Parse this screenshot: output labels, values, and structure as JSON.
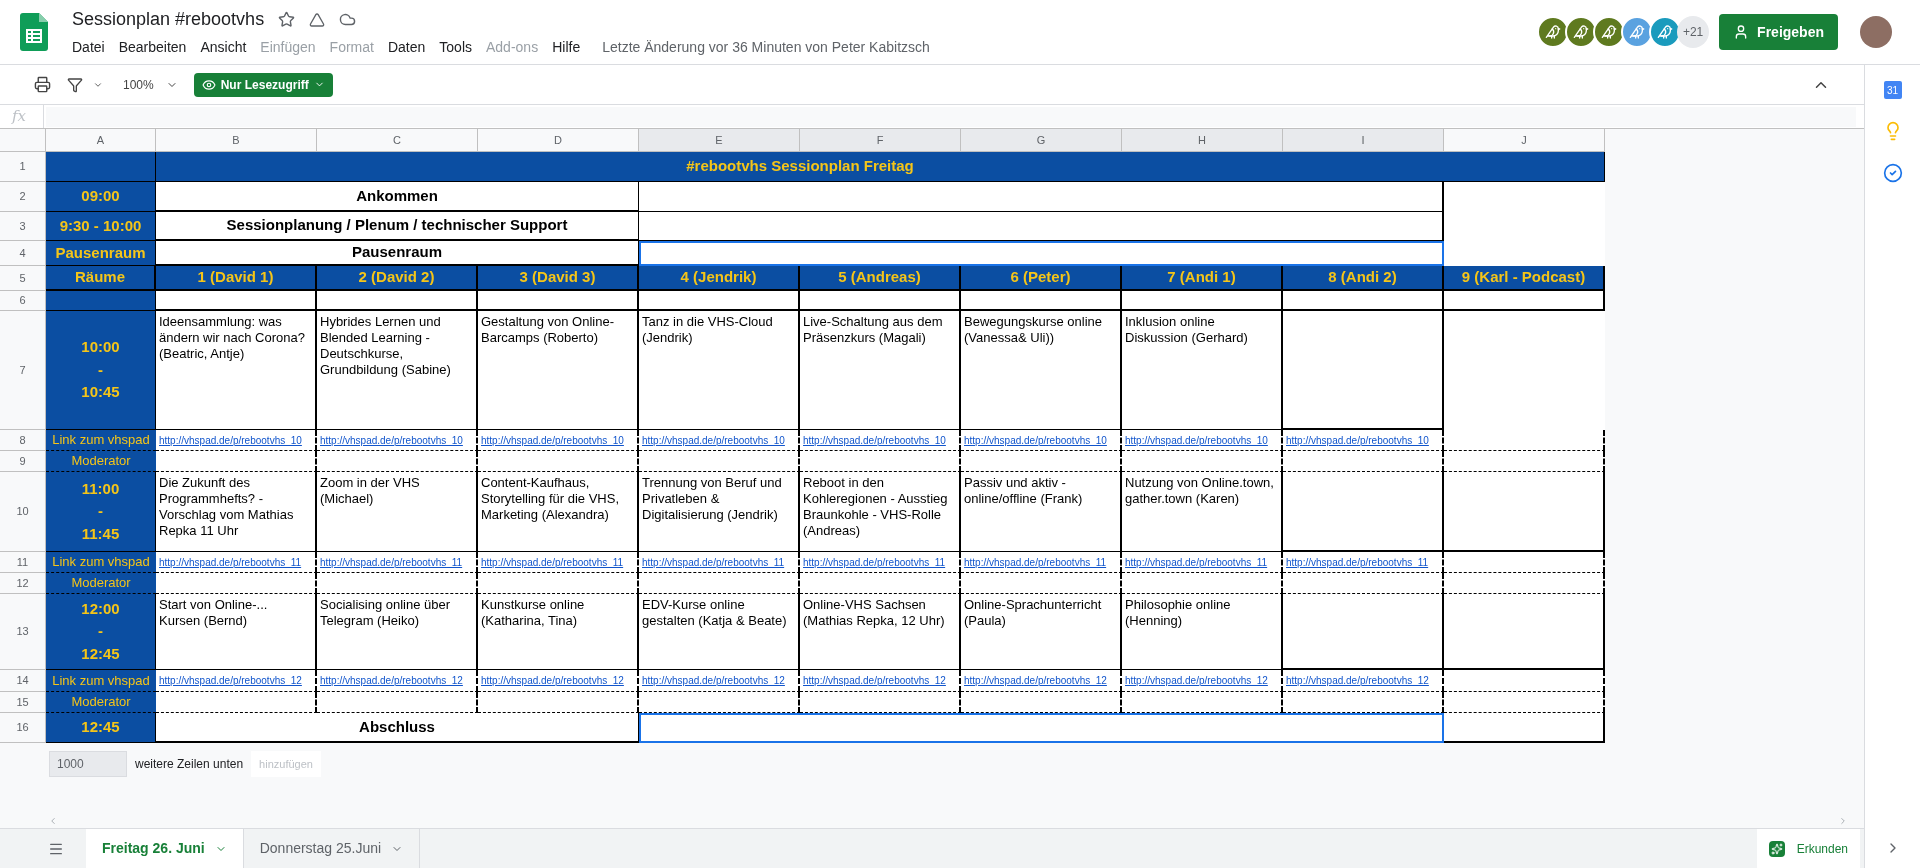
{
  "document": {
    "title": "Sessionplan #rebootvhs",
    "last_edit": "Letzte Änderung vor 36 Minuten von Peter Kabitzsch"
  },
  "menu": [
    {
      "label": "Datei",
      "disabled": false
    },
    {
      "label": "Bearbeiten",
      "disabled": false
    },
    {
      "label": "Ansicht",
      "disabled": false
    },
    {
      "label": "Einfügen",
      "disabled": true
    },
    {
      "label": "Format",
      "disabled": true
    },
    {
      "label": "Daten",
      "disabled": false
    },
    {
      "label": "Tools",
      "disabled": false
    },
    {
      "label": "Add-ons",
      "disabled": true
    },
    {
      "label": "Hilfe",
      "disabled": false
    }
  ],
  "collaborators": {
    "avatars": [
      {
        "color": "#5f7a1f"
      },
      {
        "color": "#5f7a1f"
      },
      {
        "color": "#5f7a1f"
      },
      {
        "color": "#5aa2e0"
      },
      {
        "color": "#1a9bbd"
      }
    ],
    "more": "+21"
  },
  "share_button": "Freigeben",
  "toolbar": {
    "zoom": "100%",
    "mode": "Nur Lesezugriff"
  },
  "formula_bar": {
    "label": "fx"
  },
  "side_panel": {
    "calendar": "31"
  },
  "columns": [
    {
      "label": "A",
      "selected": false
    },
    {
      "label": "B",
      "selected": false
    },
    {
      "label": "C",
      "selected": false
    },
    {
      "label": "D",
      "selected": false
    },
    {
      "label": "E",
      "selected": true
    },
    {
      "label": "F",
      "selected": true
    },
    {
      "label": "G",
      "selected": true
    },
    {
      "label": "H",
      "selected": true
    },
    {
      "label": "I",
      "selected": true
    },
    {
      "label": "J",
      "selected": false
    }
  ],
  "rows": [
    {
      "number": "1",
      "cells": [
        {
          "kind": "blue"
        },
        {
          "kind": "title",
          "text": "#rebootvhs Sessionplan Freitag"
        },
        {
          "kind": "blue"
        }
      ]
    },
    {
      "number": "2",
      "cells": [
        {
          "kind": "time",
          "lines": [
            "09:00"
          ]
        },
        {
          "kind": "heading",
          "text": "Ankommen"
        },
        {
          "kind": "wide"
        },
        {
          "kind": "none"
        }
      ]
    },
    {
      "number": "3",
      "cells": [
        {
          "kind": "time",
          "lines": [
            "9:30 - 10:00"
          ]
        },
        {
          "kind": "heading",
          "text": "Sessionplanung / Plenum / technischer Support"
        },
        {
          "kind": "wide"
        },
        {
          "kind": "none"
        }
      ]
    },
    {
      "number": "4",
      "cells": [
        {
          "kind": "time",
          "lines": [
            "Pausenraum"
          ]
        },
        {
          "kind": "heading",
          "text": "Pausenraum"
        },
        {
          "kind": "outlined"
        },
        {
          "kind": "none"
        }
      ]
    },
    {
      "number": "5",
      "cells": [
        {
          "kind": "header",
          "text": "Räume"
        },
        {
          "kind": "header",
          "text": "1 (David 1)"
        },
        {
          "kind": "header",
          "text": "2 (David 2)"
        },
        {
          "kind": "header",
          "text": "3 (David 3)"
        },
        {
          "kind": "header",
          "text": "4 (Jendrik)"
        },
        {
          "kind": "header",
          "text": "5 (Andreas)"
        },
        {
          "kind": "header",
          "text": "6 (Peter)"
        },
        {
          "kind": "header",
          "text": "7 (Andi 1)"
        },
        {
          "kind": "header",
          "text": "8 (Andi 2)"
        },
        {
          "kind": "header",
          "text": "9 (Karl - Podcast)"
        }
      ]
    },
    {
      "number": "6",
      "cells": [
        {
          "kind": "blue"
        },
        {
          "kind": "empty"
        },
        {
          "kind": "empty"
        },
        {
          "kind": "empty"
        },
        {
          "kind": "empty"
        },
        {
          "kind": "empty"
        },
        {
          "kind": "empty"
        },
        {
          "kind": "empty"
        },
        {
          "kind": "empty"
        },
        {
          "kind": "empty"
        }
      ]
    },
    {
      "number": "7",
      "cells": [
        {
          "kind": "time",
          "lines": [
            "10:00",
            "-",
            "10:45"
          ]
        },
        {
          "kind": "session",
          "text": "Ideensammlung: was ändern wir nach Corona? (Beatric, Antje)"
        },
        {
          "kind": "session",
          "text": "Hybrides Lernen und Blended Learning - Deutschkurse, Grundbildung (Sabine)"
        },
        {
          "kind": "session",
          "text": "Gestaltung von Online-Barcamps (Roberto)"
        },
        {
          "kind": "session",
          "text": "Tanz in die VHS-Cloud (Jendrik)"
        },
        {
          "kind": "session",
          "text": "Live-Schaltung aus dem Präsenzkurs (Magali)"
        },
        {
          "kind": "session",
          "text": "Bewegungskurse online (Vanessa& Uli))"
        },
        {
          "kind": "session",
          "text": "Inklusion online Diskussion (Gerhard)"
        },
        {
          "kind": "empty"
        },
        {
          "kind": "none"
        }
      ]
    },
    {
      "number": "8",
      "cells": [
        {
          "kind": "label",
          "text": "Link zum vhspad"
        },
        {
          "kind": "link",
          "text": "http://vhspad.de/p/rebootvhs_10"
        },
        {
          "kind": "link",
          "text": "http://vhspad.de/p/rebootvhs_10"
        },
        {
          "kind": "link",
          "text": "http://vhspad.de/p/rebootvhs_10"
        },
        {
          "kind": "link",
          "text": "http://vhspad.de/p/rebootvhs_10"
        },
        {
          "kind": "link",
          "text": "http://vhspad.de/p/rebootvhs_10"
        },
        {
          "kind": "link",
          "text": "http://vhspad.de/p/rebootvhs_10"
        },
        {
          "kind": "link",
          "text": "http://vhspad.de/p/rebootvhs_10"
        },
        {
          "kind": "link",
          "text": "http://vhspad.de/p/rebootvhs_10"
        },
        {
          "kind": "dashed"
        }
      ]
    },
    {
      "number": "9",
      "cells": [
        {
          "kind": "label",
          "text": "Moderator"
        },
        {
          "kind": "dashed"
        },
        {
          "kind": "dashed"
        },
        {
          "kind": "dashed"
        },
        {
          "kind": "dashed"
        },
        {
          "kind": "dashed"
        },
        {
          "kind": "dashed"
        },
        {
          "kind": "dashed"
        },
        {
          "kind": "dashed"
        },
        {
          "kind": "dashed"
        }
      ]
    },
    {
      "number": "10",
      "cells": [
        {
          "kind": "time",
          "lines": [
            "11:00",
            "-",
            "11:45"
          ]
        },
        {
          "kind": "session",
          "text": "Die Zukunft des Programmhefts? - Vorschlag vom Mathias Repka 11 Uhr"
        },
        {
          "kind": "session",
          "text": "Zoom in der VHS (Michael)"
        },
        {
          "kind": "session",
          "text": "Content-Kaufhaus, Storytelling für die VHS, Marketing (Alexandra)"
        },
        {
          "kind": "session",
          "text": "Trennung von Beruf und Privatleben & Digitalisierung (Jendrik)"
        },
        {
          "kind": "session",
          "text": "Reboot in den Kohleregionen - Ausstieg Braunkohle - VHS-Rolle (Andreas)"
        },
        {
          "kind": "session",
          "text": "Passiv und aktiv - online/offline (Frank)"
        },
        {
          "kind": "session",
          "text": "Nutzung von Online.town, gather.town (Karen)"
        },
        {
          "kind": "empty"
        },
        {
          "kind": "empty"
        }
      ]
    },
    {
      "number": "11",
      "cells": [
        {
          "kind": "label",
          "text": "Link zum vhspad"
        },
        {
          "kind": "link",
          "text": "http://vhspad.de/p/rebootvhs_11"
        },
        {
          "kind": "link",
          "text": "http://vhspad.de/p/rebootvhs_11"
        },
        {
          "kind": "link",
          "text": "http://vhspad.de/p/rebootvhs_11"
        },
        {
          "kind": "link",
          "text": "http://vhspad.de/p/rebootvhs_11"
        },
        {
          "kind": "link",
          "text": "http://vhspad.de/p/rebootvhs_11"
        },
        {
          "kind": "link",
          "text": "http://vhspad.de/p/rebootvhs_11"
        },
        {
          "kind": "link",
          "text": "http://vhspad.de/p/rebootvhs_11"
        },
        {
          "kind": "link",
          "text": "http://vhspad.de/p/rebootvhs_11"
        },
        {
          "kind": "dashed"
        }
      ]
    },
    {
      "number": "12",
      "cells": [
        {
          "kind": "label",
          "text": "Moderator"
        },
        {
          "kind": "dashed"
        },
        {
          "kind": "dashed"
        },
        {
          "kind": "dashed"
        },
        {
          "kind": "dashed"
        },
        {
          "kind": "dashed"
        },
        {
          "kind": "dashed"
        },
        {
          "kind": "dashed"
        },
        {
          "kind": "dashed"
        },
        {
          "kind": "dashed"
        }
      ]
    },
    {
      "number": "13",
      "cells": [
        {
          "kind": "time",
          "lines": [
            "12:00",
            "-",
            "12:45"
          ]
        },
        {
          "kind": "session",
          "text": "Start von  Online-... Kursen (Bernd)"
        },
        {
          "kind": "session",
          "text": "Socialising online über Telegram (Heiko)"
        },
        {
          "kind": "session",
          "text": "Kunstkurse online (Katharina, Tina)"
        },
        {
          "kind": "session",
          "text": "EDV-Kurse online gestalten (Katja & Beate)"
        },
        {
          "kind": "session",
          "text": "Online-VHS Sachsen (Mathias Repka, 12 Uhr)"
        },
        {
          "kind": "session",
          "text": "Online-Sprachunterricht (Paula)"
        },
        {
          "kind": "session",
          "text": "Philosophie online (Henning)"
        },
        {
          "kind": "empty"
        },
        {
          "kind": "empty"
        }
      ]
    },
    {
      "number": "14",
      "cells": [
        {
          "kind": "label",
          "text": "Link zum vhspad"
        },
        {
          "kind": "link",
          "text": "http://vhspad.de/p/rebootvhs_12"
        },
        {
          "kind": "link",
          "text": "http://vhspad.de/p/rebootvhs_12"
        },
        {
          "kind": "link",
          "text": "http://vhspad.de/p/rebootvhs_12"
        },
        {
          "kind": "link",
          "text": "http://vhspad.de/p/rebootvhs_12"
        },
        {
          "kind": "link",
          "text": "http://vhspad.de/p/rebootvhs_12"
        },
        {
          "kind": "link",
          "text": "http://vhspad.de/p/rebootvhs_12"
        },
        {
          "kind": "link",
          "text": "http://vhspad.de/p/rebootvhs_12"
        },
        {
          "kind": "link",
          "text": "http://vhspad.de/p/rebootvhs_12"
        },
        {
          "kind": "dashed"
        }
      ]
    },
    {
      "number": "15",
      "cells": [
        {
          "kind": "label",
          "text": "Moderator"
        },
        {
          "kind": "dashed"
        },
        {
          "kind": "dashed"
        },
        {
          "kind": "dashed"
        },
        {
          "kind": "dashed"
        },
        {
          "kind": "dashed"
        },
        {
          "kind": "dashed"
        },
        {
          "kind": "dashed"
        },
        {
          "kind": "dashed"
        },
        {
          "kind": "dashed"
        }
      ]
    },
    {
      "number": "16",
      "cells": [
        {
          "kind": "time",
          "lines": [
            "12:45"
          ]
        },
        {
          "kind": "heading",
          "text": "Abschluss"
        },
        {
          "kind": "outlined"
        },
        {
          "kind": "empty"
        }
      ]
    }
  ],
  "add_rows": {
    "value": "1000",
    "text": "weitere Zeilen unten",
    "button": "hinzufügen"
  },
  "sheet_tabs": [
    {
      "label": "Freitag 26. Juni",
      "selected": true
    },
    {
      "label": "Donnerstag 25.Juni",
      "selected": false
    }
  ],
  "explore_button": "Erkunden"
}
